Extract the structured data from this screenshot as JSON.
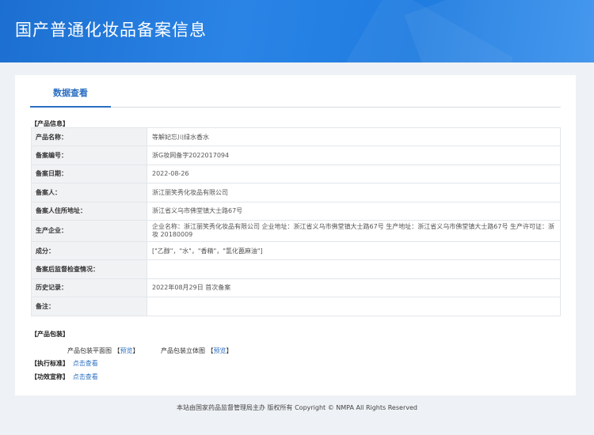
{
  "header": {
    "title": "国产普通化妆品备案信息"
  },
  "tabs": [
    {
      "label": "数据查看"
    }
  ],
  "product_section": {
    "label": "【产品信息】"
  },
  "rows": [
    {
      "label": "产品名称：",
      "value": "等解妃忘川绿水香水"
    },
    {
      "label": "备案编号：",
      "value": "浙G妆网备字2022017094"
    },
    {
      "label": "备案日期：",
      "value": "2022-08-26"
    },
    {
      "label": "备案人：",
      "value": "浙江丽笑秀化妆品有限公司"
    },
    {
      "label": "备案人住所地址：",
      "value": "浙江省义乌市佛堂镇大士路67号"
    },
    {
      "label": "生产企业：",
      "value": "企业名称：浙江丽笑秀化妆品有限公司 企业地址：浙江省义乌市佛堂镇大士路67号 生产地址：浙江省义乌市佛堂镇大士路67号 生产许可证：浙妆 20180009"
    },
    {
      "label": "成分：",
      "value": "[\"乙醇\"，\"水\"，\"香精\"，\"氢化蓖麻油\"]"
    },
    {
      "label": "备案后监督检查情况：",
      "value": ""
    },
    {
      "label": "历史记录：",
      "value": "2022年08月29日 首次备案"
    },
    {
      "label": "备注：",
      "value": ""
    }
  ],
  "packaging": {
    "label": "【产品包装】",
    "flat_label": "产品包装平面图",
    "flat_link": "预览",
    "solid_label": "产品包装立体图",
    "solid_link": "预览"
  },
  "standard": {
    "label": "【执行标准】",
    "link": "点击查看"
  },
  "efficacy": {
    "label": "【功效宣称】",
    "link": "点击查看"
  },
  "footer": {
    "text": "本站由国家药品监督管理局主办 版权所有 Copyright © NMPA All Rights Reserved"
  },
  "colors": {
    "header_blue": "#1f7ce0",
    "accent": "#2a6ec2",
    "border": "#9dbfe3"
  }
}
